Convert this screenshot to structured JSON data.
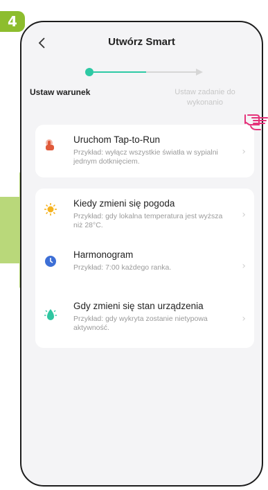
{
  "step_number": "4",
  "header": {
    "title": "Utwórz Smart"
  },
  "progress": {
    "step1_label": "Ustaw warunek",
    "step2_label": "Ustaw zadanie do wykonanio"
  },
  "options": [
    {
      "title": "Uruchom Tap-to-Run",
      "desc": "Przykład: wyłącz wszystkie światła w sypialni jednym dotknięciem.",
      "icon": "tap-hand-icon",
      "color": "#e05a3a"
    },
    {
      "title": "Kiedy zmieni się pogoda",
      "desc": "Przykład: gdy lokalna temperatura jest wyższa niż 28°C.",
      "icon": "sun-icon",
      "color": "#f5b21f"
    },
    {
      "title": "Harmonogram",
      "desc": "Przykład: 7:00 każdego ranka.",
      "icon": "clock-icon",
      "color": "#3d6fd6"
    },
    {
      "title": "Gdy zmieni się stan urządzenia",
      "desc": "Przykład: gdy wykryta zostanie nietypowa aktywność.",
      "icon": "device-icon",
      "color": "#2fc6a1"
    }
  ],
  "colors": {
    "accent": "#2dc9a4",
    "badge": "#8dbd2e",
    "highlight_arrow": "#b9d87a",
    "pointer": "#e5327a"
  }
}
